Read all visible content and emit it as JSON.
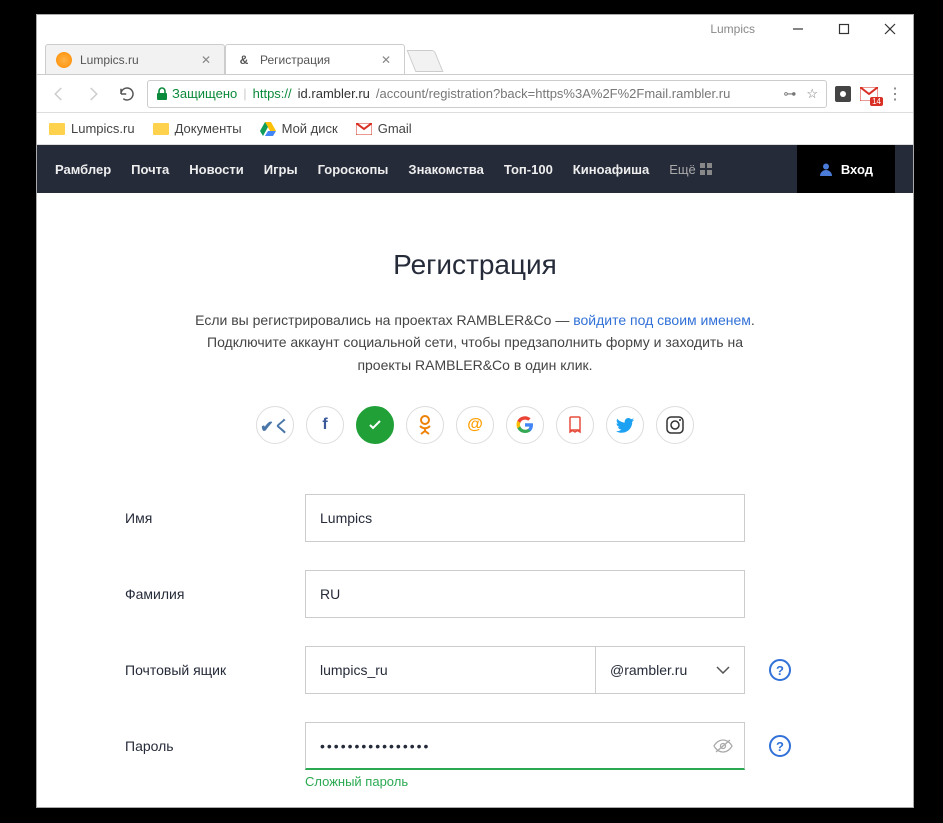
{
  "window": {
    "title": "Lumpics"
  },
  "tabs": [
    {
      "label": "Lumpics.ru",
      "active": false
    },
    {
      "label": "Регистрация",
      "active": true
    }
  ],
  "addrbar": {
    "secure_label": "Защищено",
    "url_scheme": "https://",
    "url_host": "id.rambler.ru",
    "url_path": "/account/registration?back=https%3A%2F%2Fmail.rambler.ru"
  },
  "gmail_count": "14",
  "bookmarks": [
    {
      "label": "Lumpics.ru"
    },
    {
      "label": "Документы"
    },
    {
      "label": "Мой диск"
    },
    {
      "label": "Gmail"
    }
  ],
  "rambler_nav": [
    "Рамблер",
    "Почта",
    "Новости",
    "Игры",
    "Гороскопы",
    "Знакомства",
    "Топ-100",
    "Киноафиша"
  ],
  "rambler_more": "Ещё",
  "rambler_login": "Вход",
  "reg": {
    "title": "Регистрация",
    "desc_pre": "Если вы регистрировались на проектах RAMBLER&Co — ",
    "desc_link": "войдите под своим именем",
    "desc_line2": "Подключите аккаунт социальной сети, чтобы предзаполнить форму и заходить на",
    "desc_line3": "проекты RAMBLER&Co в один клик."
  },
  "form": {
    "name_label": "Имя",
    "name_value": "Lumpics",
    "surname_label": "Фамилия",
    "surname_value": "RU",
    "email_label": "Почтовый ящик",
    "email_value": "lumpics_ru",
    "email_domain": "@rambler.ru",
    "password_label": "Пароль",
    "password_value": "••••••••••••••••",
    "password_msg": "Сложный пароль",
    "help": "?"
  }
}
